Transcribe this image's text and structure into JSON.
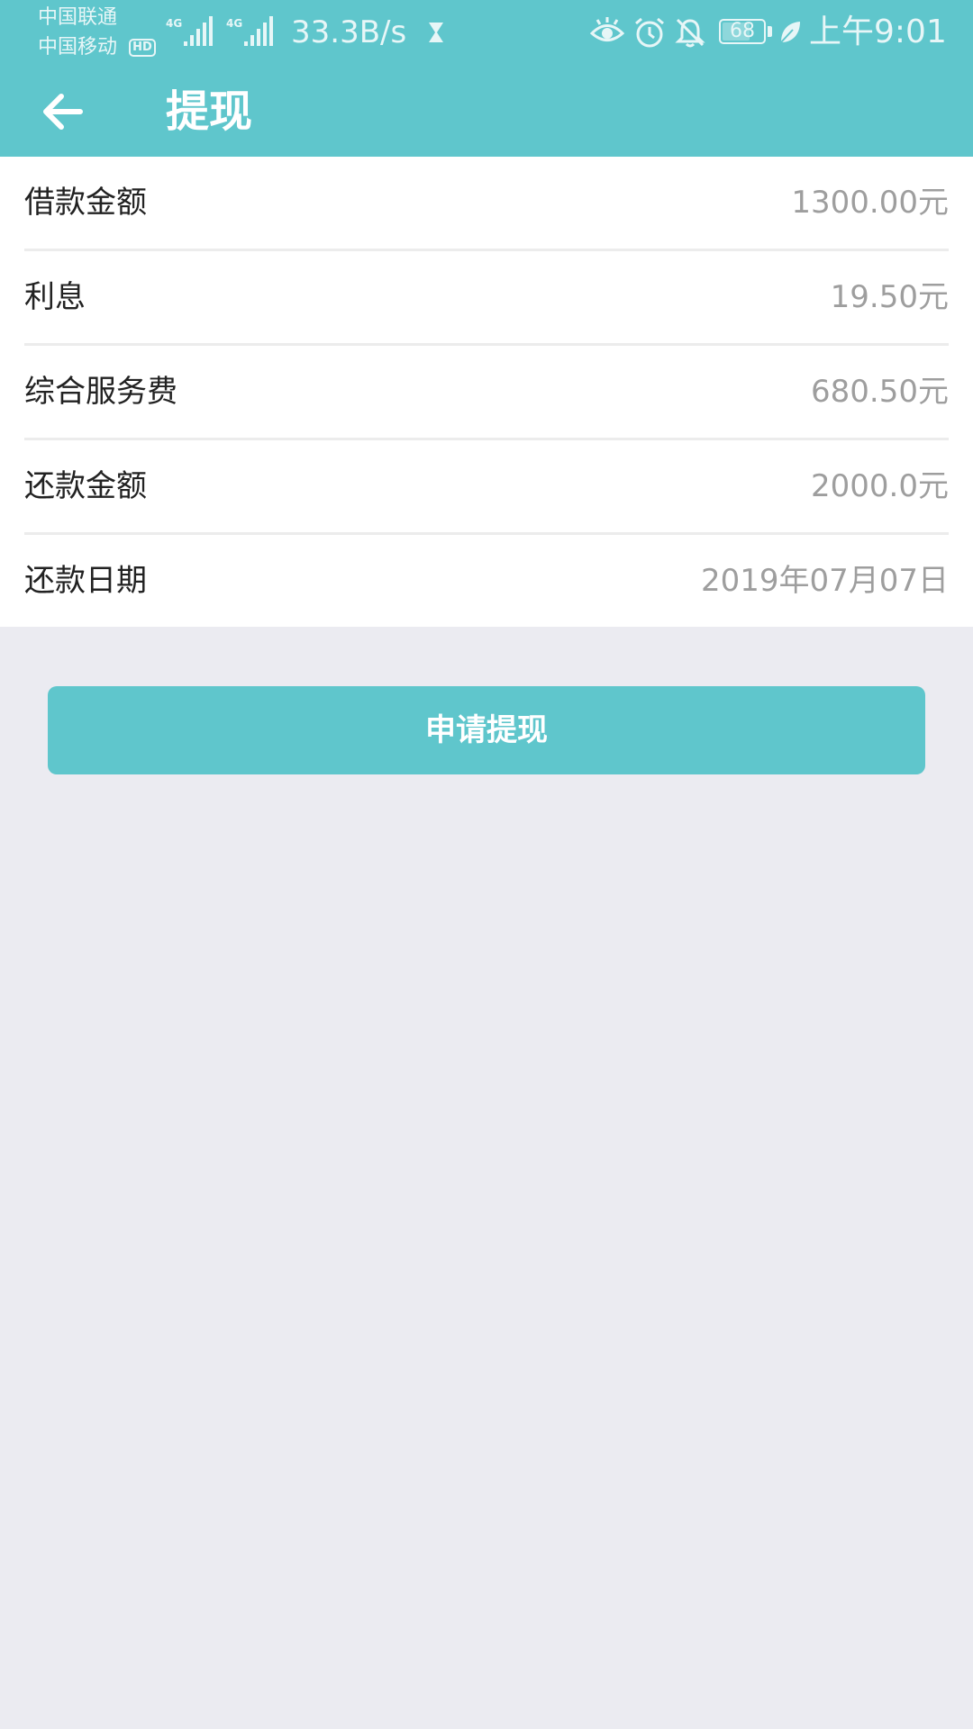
{
  "status_bar": {
    "carrier_1": "中国联通",
    "carrier_2": "中国移动",
    "hd_badge": "HD",
    "network_type_1": "4G",
    "network_type_2": "4G",
    "net_speed": "33.3B/s",
    "battery_level": "68",
    "time": "上午9:01",
    "icons": [
      "hourglass-icon",
      "eye-icon",
      "alarm-icon",
      "bell-off-icon",
      "battery-icon",
      "leaf-icon"
    ]
  },
  "header": {
    "back_icon": "arrow-left-icon",
    "title": "提现"
  },
  "details": [
    {
      "label": "借款金额",
      "value": "1300.00元"
    },
    {
      "label": "利息",
      "value": "19.50元"
    },
    {
      "label": "综合服务费",
      "value": "680.50元"
    },
    {
      "label": "还款金额",
      "value": "2000.0元"
    },
    {
      "label": "还款日期",
      "value": "2019年07月07日"
    }
  ],
  "actions": {
    "submit_label": "申请提现"
  },
  "colors": {
    "primary": "#5fc6cc",
    "background": "#ebebf1",
    "value_text": "#9e9e9e",
    "label_text": "#222222"
  }
}
